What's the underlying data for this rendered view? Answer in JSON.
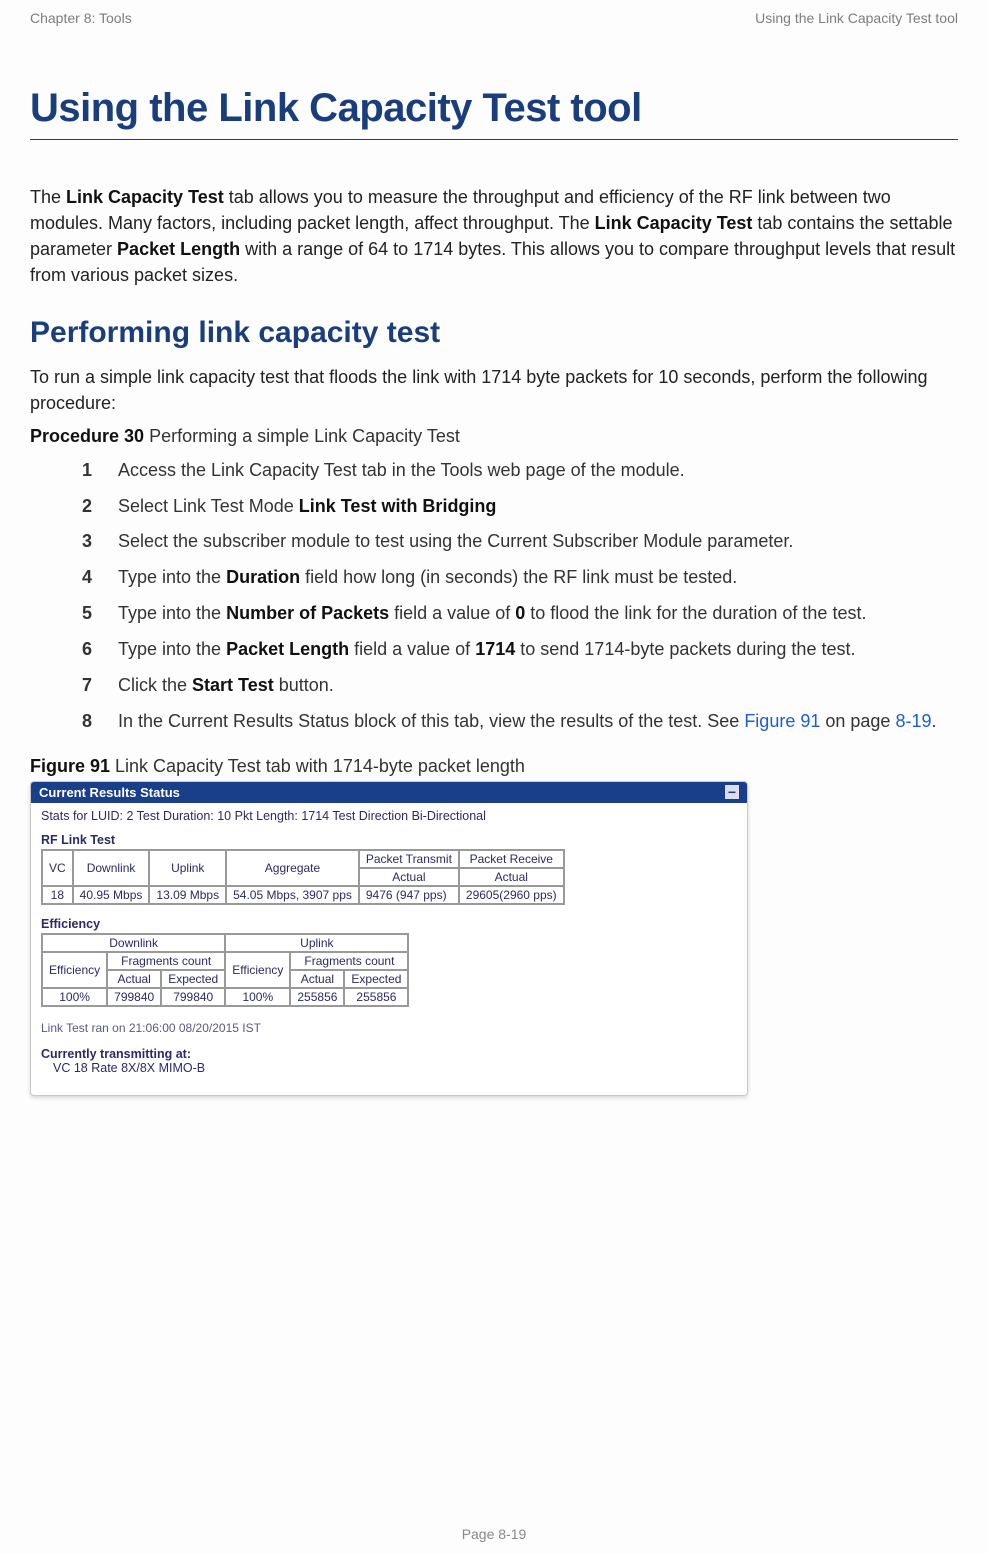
{
  "header": {
    "left": "Chapter 8:  Tools",
    "right": "Using the Link Capacity Test tool"
  },
  "title": "Using the Link Capacity Test tool",
  "intro": {
    "t1": "The ",
    "b1": "Link Capacity Test",
    "t2": " tab allows you to measure the throughput and efficiency of the RF link between two modules. Many factors, including packet length, affect throughput. The ",
    "b2": "Link Capacity Test",
    "t3": " tab contains the settable parameter ",
    "b3": "Packet Length",
    "t4": " with a range of 64 to 1714 bytes. This allows you to compare throughput levels that result from various packet sizes."
  },
  "subtitle": "Performing link capacity test",
  "lead": "To run a simple link capacity test that floods the link with 1714 byte packets for 10 seconds, perform the following procedure:",
  "procedure": {
    "label": "Procedure 30",
    "caption": "  Performing a simple Link Capacity Test"
  },
  "steps": {
    "s1": "Access the Link Capacity Test tab in the Tools web page of the module.",
    "s2a": "Select Link Test Mode ",
    "s2b": "Link Test with Bridging",
    "s3": "Select the subscriber module to test using the Current Subscriber Module parameter.",
    "s4a": "Type into the ",
    "s4b": "Duration",
    "s4c": " field how long (in seconds) the RF link must be tested.",
    "s5a": "Type into the ",
    "s5b": "Number of Packets",
    "s5c": " field a value of ",
    "s5d": "0",
    "s5e": " to flood the link for the duration of the test.",
    "s6a": "Type into the ",
    "s6b": "Packet Length",
    "s6c": " field a value of ",
    "s6d": "1714",
    "s6e": " to send 1714-byte packets during the test.",
    "s7a": "Click the ",
    "s7b": "Start Test",
    "s7c": " button.",
    "s8a": "In the Current Results Status block of this tab, view the results of the test. See ",
    "s8b": "Figure 91",
    "s8c": " on page ",
    "s8d": "8-19",
    "s8e": "."
  },
  "figure": {
    "label": "Figure 91",
    "caption": "  Link Capacity Test tab with 1714-byte packet length"
  },
  "shot": {
    "titlebar": "Current Results Status",
    "info": "Stats for LUID: 2   Test Duration: 10   Pkt Length: 1714   Test Direction Bi-Directional",
    "rfLabel": "RF Link Test",
    "rf": {
      "h": {
        "vc": "VC",
        "dl": "Downlink",
        "ul": "Uplink",
        "agg": "Aggregate",
        "ptx": "Packet Transmit",
        "prx": "Packet Receive",
        "act": "Actual"
      },
      "r": {
        "vc": "18",
        "dl": "40.95 Mbps",
        "ul": "13.09 Mbps",
        "agg": "54.05 Mbps,  3907 pps",
        "ptx": "9476 (947 pps)",
        "prx": "29605(2960 pps)"
      }
    },
    "effLabel": "Efficiency",
    "eff": {
      "h": {
        "dl": "Downlink",
        "ul": "Uplink",
        "eff": "Efficiency",
        "frag": "Fragments count",
        "act": "Actual",
        "exp": "Expected"
      },
      "r": {
        "dlEff": "100%",
        "dlAct": "799840",
        "dlExp": "799840",
        "ulEff": "100%",
        "ulAct": "255856",
        "ulExp": "255856"
      }
    },
    "note": "Link Test ran on 21:06:00 08/20/2015 IST",
    "current": "Currently transmitting at:",
    "rate": "VC 18 Rate 8X/8X MIMO-B"
  },
  "footer": "Page 8-19"
}
